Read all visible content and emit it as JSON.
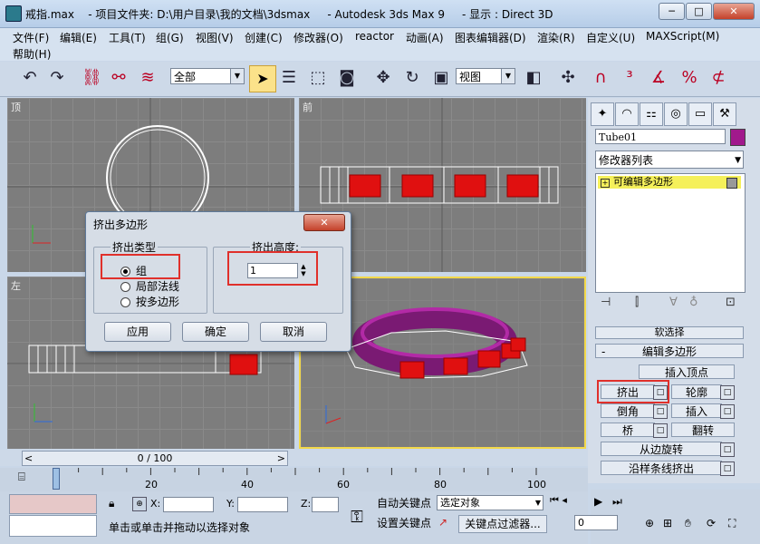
{
  "window": {
    "title": "戒指.max    - 项目文件夹: D:\\用户目录\\我的文档\\3dsmax     - Autodesk 3ds Max 9     - 显示 : Direct 3D",
    "min_glyph": "─",
    "max_glyph": "□",
    "close_glyph": "✕"
  },
  "menu": {
    "items": [
      "文件(F)",
      "编辑(E)",
      "工具(T)",
      "组(G)",
      "视图(V)",
      "创建(C)",
      "修改器(O)",
      "reactor",
      "动画(A)",
      "图表编辑器(D)",
      "渲染(R)",
      "自定义(U)",
      "MAXScript(M)"
    ],
    "help": "帮助(H)"
  },
  "toolbar": {
    "filter_select": "全部",
    "view_select": "视图"
  },
  "viewports": {
    "top": "顶",
    "front": "前",
    "left": "左",
    "persp": ""
  },
  "command_panel": {
    "object_name": "Tube01",
    "object_color": "#a1198c",
    "modifier_list": "修改器列表",
    "stack_item": "可编辑多边形",
    "rollout_soft": "软选择",
    "rollout_edit": "编辑多边形",
    "btn_insert_vertex": "插入顶点",
    "btn_extrude": "挤出",
    "btn_outline": "轮廓",
    "btn_bevel": "倒角",
    "btn_inset": "插入",
    "btn_bridge": "桥",
    "btn_flip": "翻转",
    "btn_hinge": "从边旋转",
    "btn_extrude_spline": "沿样条线挤出"
  },
  "dialog": {
    "title": "挤出多边形",
    "close": "✕",
    "group_type": "挤出类型",
    "opt_group": "组",
    "opt_local": "局部法线",
    "opt_bypoly": "按多边形",
    "group_height": "挤出高度:",
    "height_value": "1",
    "btn_apply": "应用",
    "btn_ok": "确定",
    "btn_cancel": "取消"
  },
  "timeline": {
    "frame": "0 / 100",
    "ticks": [
      "0",
      "20",
      "40",
      "60",
      "80",
      "100"
    ]
  },
  "status": {
    "x_label": "X:",
    "y_label": "Y:",
    "z_label": "Z:",
    "auto_key": "自动关键点",
    "set_key": "设置关键点",
    "key_filter_select": "选定对象",
    "key_filter_btn": "关键点过滤器...",
    "prompt": "单击或单击并拖动以选择对象",
    "frame_field": "0"
  },
  "colors": {
    "accent_red": "#e0302b",
    "viewport_active": "#f2d84a",
    "stack_highlight": "#f5f05a"
  }
}
